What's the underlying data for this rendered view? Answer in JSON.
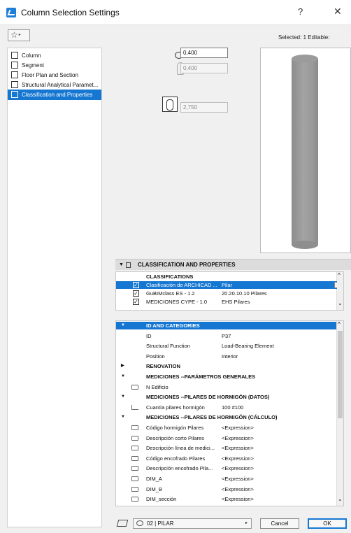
{
  "window": {
    "title": "Column Selection Settings",
    "help": "?",
    "close": "✕"
  },
  "toolbar": {
    "favorites_icon": "☆",
    "favorites_arrow": "▸",
    "selected_text": "Selected: 1 Editable:"
  },
  "sidebar": {
    "items": [
      {
        "label": "Column",
        "icon": "column-icon"
      },
      {
        "label": "Segment",
        "icon": "segment-icon"
      },
      {
        "label": "Floor Plan and Section",
        "icon": "floor-plan-icon"
      },
      {
        "label": "Structural Analytical Paramet...",
        "icon": "structural-icon"
      },
      {
        "label": "Classification and Properties",
        "icon": "classification-icon",
        "active": true
      }
    ]
  },
  "geometry": {
    "width_value": "0,400",
    "height_value": "0,400",
    "column_height_value": "2,750"
  },
  "section": {
    "title": "CLASSIFICATION AND PROPERTIES",
    "toggle": "▼"
  },
  "classifications": {
    "header": "CLASSIFICATIONS",
    "rows": [
      {
        "name": "Clasificación de ARCHICAD ...",
        "value": "Pilar",
        "checked": "✓",
        "selected": true,
        "arrow": "▸"
      },
      {
        "name": "GuBIMclass ES - 1.2",
        "value": "20.20.10.10 Pilares",
        "checked": "✓"
      },
      {
        "name": "MEDICIONES CYPE - 1.0",
        "value": "EHS Pilares",
        "checked": "✓"
      }
    ],
    "scroll_up": "^",
    "scroll_down": "⌄"
  },
  "properties": {
    "scroll_up": "^",
    "scroll_down": "⌄",
    "rows": [
      {
        "type": "group",
        "label": "ID AND CATEGORIES",
        "toggle": "▼",
        "blue": true
      },
      {
        "type": "prop",
        "name": "ID",
        "value": "P37"
      },
      {
        "type": "prop",
        "name": "Structural Function",
        "value": "Load-Bearing Element"
      },
      {
        "type": "prop",
        "name": "Position",
        "value": "Interior"
      },
      {
        "type": "group",
        "label": "RENOVATION",
        "toggle": "▶"
      },
      {
        "type": "group",
        "label": "MEDICIONES --PARÁMETROS GENERALES",
        "toggle": "▼"
      },
      {
        "type": "prop",
        "name": "N Edificio",
        "value": "",
        "icon": "pic"
      },
      {
        "type": "group",
        "label": "MEDICIONES --PILARES DE HORMIGÓN (DATOS)",
        "toggle": "▼"
      },
      {
        "type": "prop",
        "name": "Cuantía pilares hormigón",
        "value": "100 #100",
        "icon": "pic2"
      },
      {
        "type": "group",
        "label": "MEDICIONES --PILARES DE HORMIGÓN (CÁLCULO)",
        "toggle": "▼"
      },
      {
        "type": "prop",
        "name": "Código hormigón Pilares",
        "value": "<Expression>",
        "icon": "pic"
      },
      {
        "type": "prop",
        "name": "Descripción corto Pilares",
        "value": "<Expression>",
        "icon": "pic"
      },
      {
        "type": "prop",
        "name": "Descripción línea de medici...",
        "value": "<Expression>",
        "icon": "pic"
      },
      {
        "type": "prop",
        "name": "Código encofrado Pilares",
        "value": "<Expression>",
        "icon": "pic"
      },
      {
        "type": "prop",
        "name": "Descripción encofrado Pila...",
        "value": "<Expression>",
        "icon": "pic"
      },
      {
        "type": "prop",
        "name": "DIM_A",
        "value": "<Expression>",
        "icon": "pic"
      },
      {
        "type": "prop",
        "name": "DIM_B",
        "value": "<Expression>",
        "icon": "pic"
      },
      {
        "type": "prop",
        "name": "DIM_sección",
        "value": "<Expression>",
        "icon": "pic"
      }
    ]
  },
  "footer": {
    "layer": "02 | PILAR",
    "layer_arrow": "▸",
    "cancel": "Cancel",
    "ok": "OK"
  },
  "colors": {
    "accent": "#1677d2"
  }
}
